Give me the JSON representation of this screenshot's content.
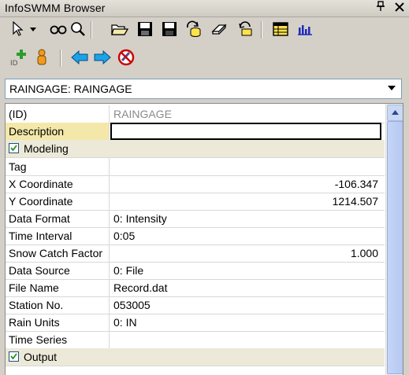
{
  "window": {
    "title": "InfoSWMM Browser",
    "pin_icon": "pin-icon",
    "close_icon": "close-icon"
  },
  "toolbar_top": {
    "buttons": [
      "pointer-select-icon",
      "dropdown-arrow-icon",
      "binoculars-find-icon",
      "magnifier-icon",
      "open-folder-icon",
      "save-icon",
      "save-all-icon",
      "refresh-database-icon",
      "eraser-icon",
      "undo-refresh-icon",
      "table-grid-icon",
      "bar-chart-icon"
    ]
  },
  "toolbar_bottom": {
    "buttons": [
      "add-node-icon",
      "user-person-icon",
      "arrow-left-icon",
      "arrow-right-icon",
      "no-edit-icon"
    ]
  },
  "object_selector": {
    "value": "RAINGAGE: RAINGAGE"
  },
  "properties": {
    "id": {
      "label": "(ID)",
      "value": "RAINGAGE"
    },
    "description": {
      "label": "Description",
      "value": ""
    },
    "modeling_section": {
      "label": "Modeling",
      "checked": true
    },
    "tag": {
      "label": "Tag",
      "value": ""
    },
    "x_coordinate": {
      "label": "X Coordinate",
      "value": "-106.347"
    },
    "y_coordinate": {
      "label": "Y Coordinate",
      "value": "1214.507"
    },
    "data_format": {
      "label": "Data Format",
      "value": "0: Intensity"
    },
    "time_interval": {
      "label": "Time Interval",
      "value": "0:05"
    },
    "snow_catch_factor": {
      "label": "Snow Catch Factor",
      "value": "1.000"
    },
    "data_source": {
      "label": "Data Source",
      "value": "0: File"
    },
    "file_name": {
      "label": "File Name",
      "value": "Record.dat"
    },
    "station_no": {
      "label": "Station No.",
      "value": "053005"
    },
    "rain_units": {
      "label": "Rain Units",
      "value": "0: IN"
    },
    "time_series": {
      "label": "Time Series",
      "value": ""
    },
    "output_section": {
      "label": "Output",
      "checked": true
    }
  },
  "colors": {
    "selected_label_bg": "#f3e8a9",
    "scrollbar": "#c5d5f7"
  }
}
